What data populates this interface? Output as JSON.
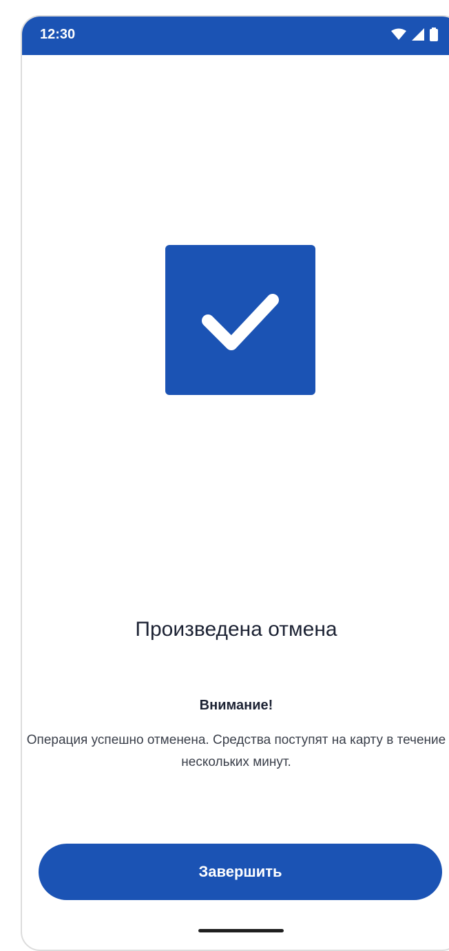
{
  "status_bar": {
    "time": "12:30",
    "icons": [
      "wifi-icon",
      "signal-icon",
      "battery-icon"
    ]
  },
  "result": {
    "icon": "checkmark-icon",
    "title": "Произведена отмена",
    "attention_label": "Внимание!",
    "message": "Операция успешно отменена. Средства поступят на карту в течение нескольких минут."
  },
  "actions": {
    "finish_label": "Завершить"
  },
  "colors": {
    "accent": "#1b53b4",
    "text_primary": "#1c2233",
    "text_secondary": "#3a3f4a"
  }
}
